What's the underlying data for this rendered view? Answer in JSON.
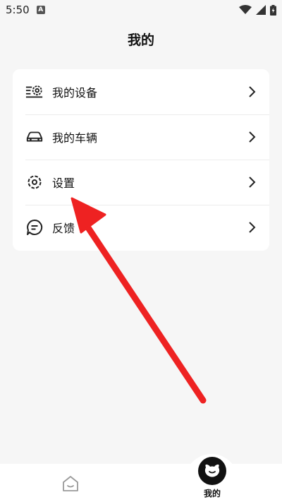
{
  "status_bar": {
    "time": "5:50",
    "notification_badge": "A",
    "icons": [
      "wifi-icon",
      "signal-icon",
      "battery-icon"
    ]
  },
  "header": {
    "title": "我的"
  },
  "menu": {
    "items": [
      {
        "label": "我的设备",
        "icon": "device-gear-icon"
      },
      {
        "label": "我的车辆",
        "icon": "car-icon"
      },
      {
        "label": "设置",
        "icon": "gear-icon"
      },
      {
        "label": "反馈",
        "icon": "feedback-icon"
      }
    ]
  },
  "bottom_nav": {
    "home_icon": "home-icon",
    "profile_label": "我的"
  },
  "colors": {
    "background": "#f6f6f6",
    "card": "#ffffff",
    "annotation_arrow": "#ee2222",
    "active_tab": "#111111"
  }
}
